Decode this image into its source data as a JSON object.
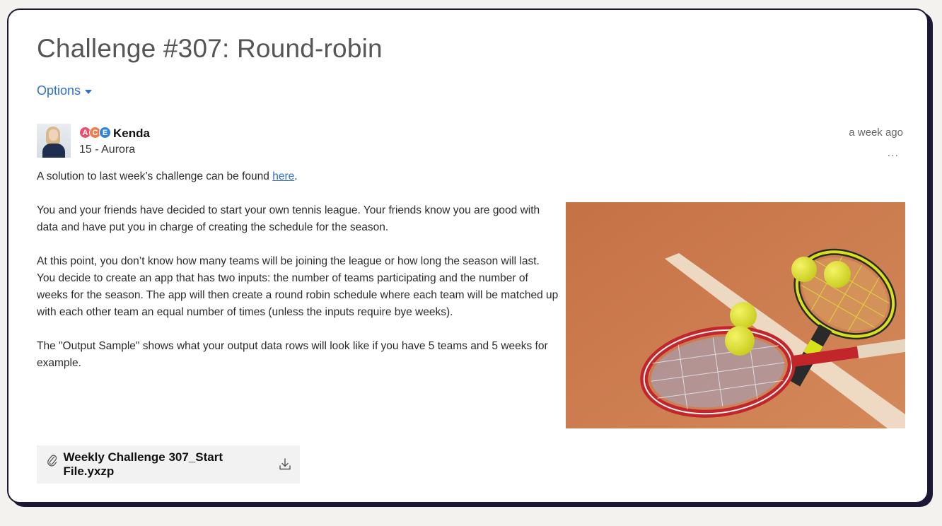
{
  "post": {
    "title": "Challenge #307: Round-robin",
    "options_label": "Options",
    "author": {
      "name": "Kenda",
      "subtitle": "15 - Aurora",
      "badges": [
        {
          "letter": "A",
          "color": "#e8506b"
        },
        {
          "letter": "C",
          "color": "#f07c4a"
        },
        {
          "letter": "E",
          "color": "#2f82d9"
        }
      ]
    },
    "timestamp": "a week ago",
    "more_label": "...",
    "intro_before_link": "A solution to last week’s challenge can be found ",
    "intro_link": "here",
    "intro_after_link": ".",
    "paragraphs": [
      "You and your friends have decided to start your own tennis league. Your friends know you are good with data and have put you in charge of creating the schedule for the season.",
      "At this point, you don’t know how many teams will be joining the league or how long the season will last. You decide to create an app that has two inputs: the number of teams participating and the number of weeks for the season. The app will then create a round robin schedule where each team will be matched up with each other team an equal number of times (unless the inputs require bye weeks).",
      "The \"Output Sample\" shows what your output data rows will look like if you have 5 teams and 5 weeks for example."
    ],
    "attachment": {
      "filename": "Weekly Challenge 307_Start File.yxzp",
      "attach_icon": "paperclip-icon",
      "download_icon": "download-icon"
    }
  },
  "colors": {
    "link": "#2f6fc9",
    "border": "#1b1836",
    "clay": "#c8784c"
  }
}
